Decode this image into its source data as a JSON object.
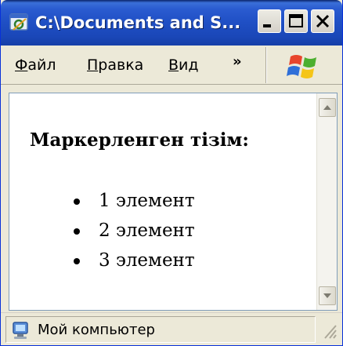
{
  "window": {
    "title": "C:\\Documents and S...",
    "title_colors": {
      "start": "#3a6fd8",
      "end": "#163fa8"
    },
    "close_button_color": "#c0392b"
  },
  "menu": {
    "items": [
      {
        "accel": "Ф",
        "rest": "айл"
      },
      {
        "accel": "П",
        "rest": "равка"
      },
      {
        "accel": "В",
        "rest": "ид"
      }
    ],
    "overflow_label": "»",
    "icons": [
      "minimize-icon",
      "maximize-icon",
      "close-icon",
      "windows-logo-icon"
    ]
  },
  "content": {
    "heading": "Маркерленген тізім:",
    "list_items": [
      "1 элемент",
      "2 элемент",
      "3 элемент"
    ]
  },
  "status": {
    "text": "Мой компьютер",
    "icon": "my-computer-icon"
  }
}
